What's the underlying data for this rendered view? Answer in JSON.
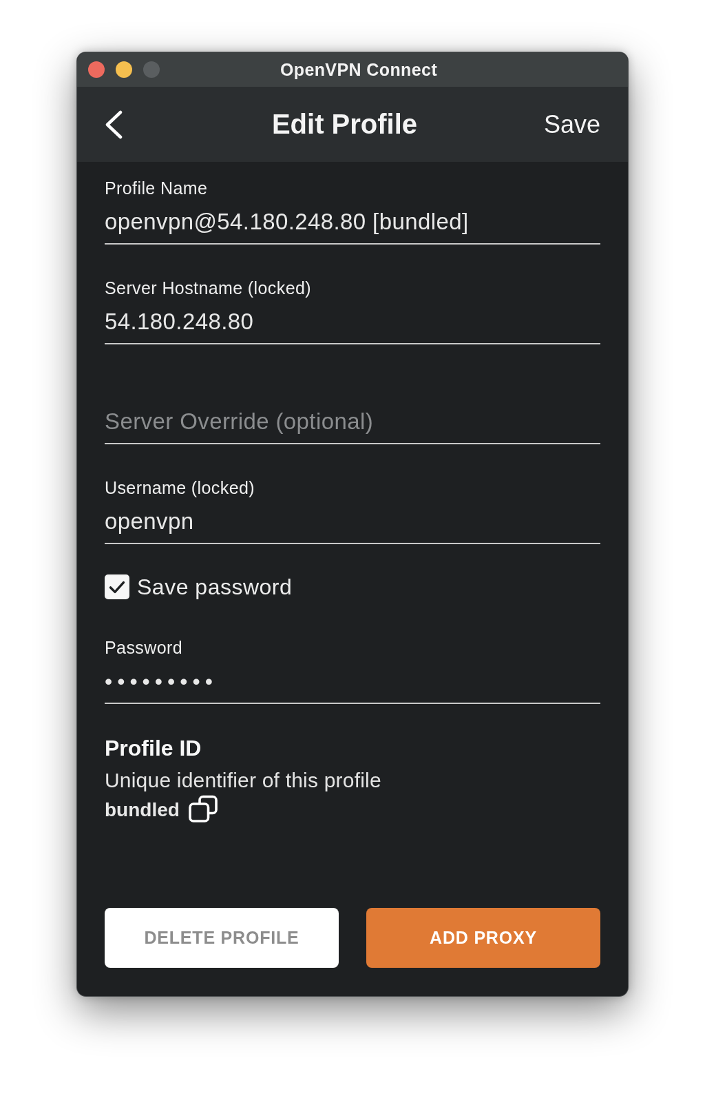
{
  "window": {
    "title": "OpenVPN Connect"
  },
  "header": {
    "title": "Edit Profile",
    "action": "Save"
  },
  "fields": [
    {
      "kind": "text",
      "label": "Profile Name",
      "value": "openvpn@54.180.248.80 [bundled]"
    },
    {
      "kind": "text",
      "label": "Server Hostname (locked)",
      "value": "54.180.248.80"
    },
    {
      "kind": "text",
      "placeholder": "Server Override (optional)"
    },
    {
      "kind": "text",
      "label": "Username (locked)",
      "value": "openvpn"
    },
    {
      "kind": "checkbox",
      "label": "Save password",
      "checked": true
    },
    {
      "kind": "password",
      "label": "Password",
      "value": "•••••••••"
    }
  ],
  "profile_id": {
    "title": "Profile ID",
    "description": "Unique identifier of this profile",
    "value": "bundled"
  },
  "buttons": [
    {
      "kind": "secondary",
      "label": "DELETE PROFILE"
    },
    {
      "kind": "primary",
      "label": "ADD PROXY"
    }
  ]
}
